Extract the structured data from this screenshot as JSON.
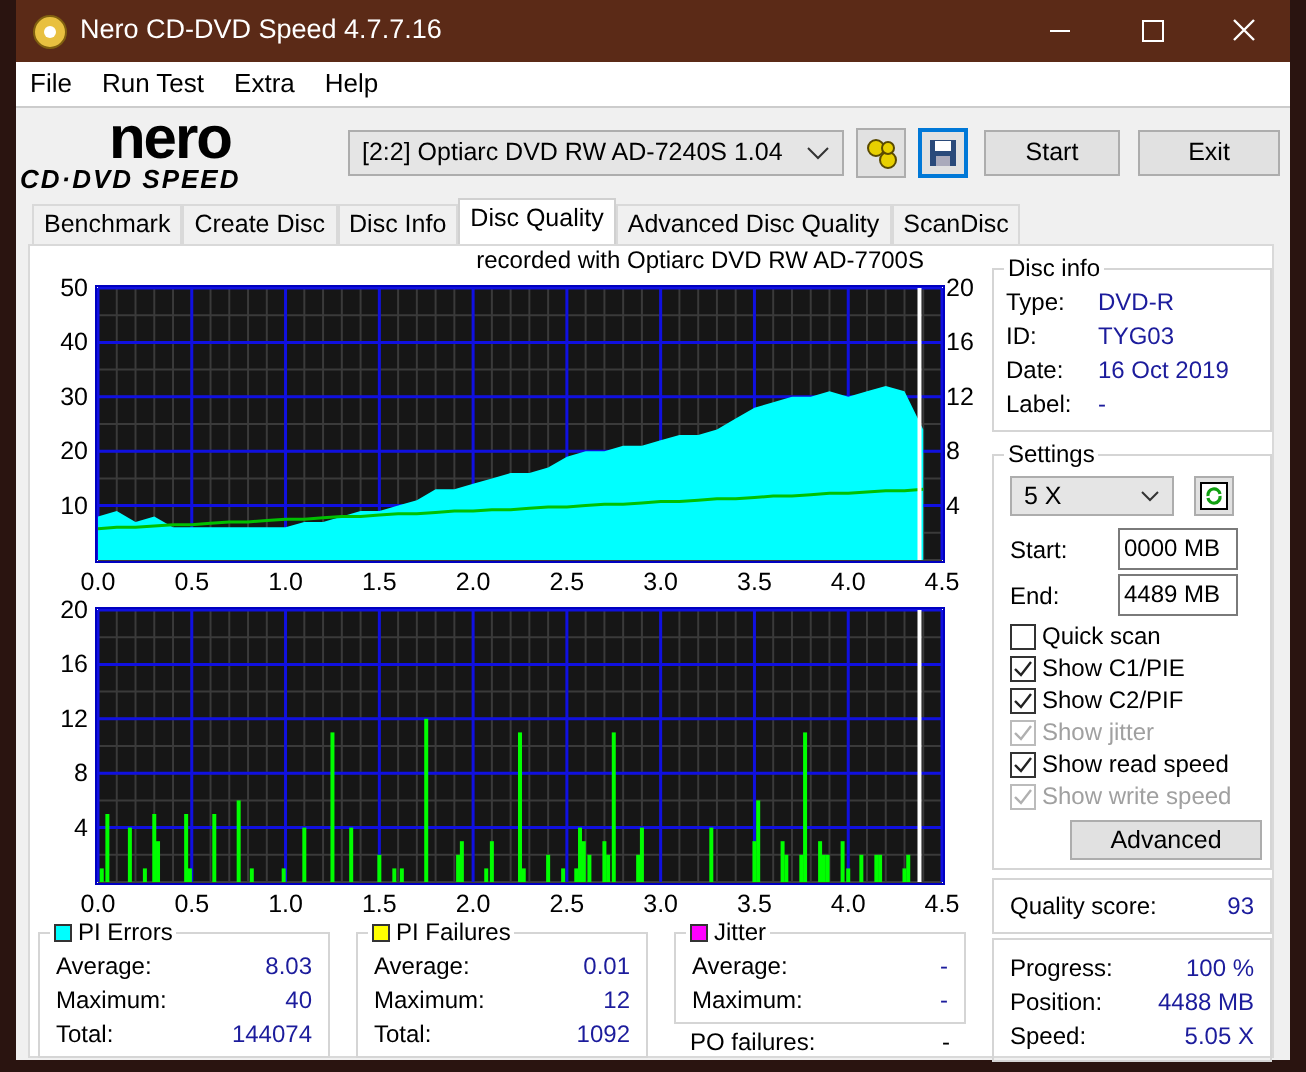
{
  "window": {
    "title": "Nero CD-DVD Speed 4.7.7.16"
  },
  "menu": [
    "File",
    "Run Test",
    "Extra",
    "Help"
  ],
  "logo": {
    "line1": "nero",
    "line2": "CD·DVD SPEED"
  },
  "toolbar": {
    "drive": "[2:2]   Optiarc DVD RW AD-7240S 1.04",
    "buttons": [
      "Start",
      "Exit"
    ]
  },
  "tabs": [
    {
      "label": "Benchmark",
      "selected": false
    },
    {
      "label": "Create Disc",
      "selected": false
    },
    {
      "label": "Disc Info",
      "selected": false
    },
    {
      "label": "Disc Quality",
      "selected": true
    },
    {
      "label": "Advanced Disc Quality",
      "selected": false
    },
    {
      "label": "ScanDisc",
      "selected": false
    }
  ],
  "chart_caption": "recorded with Optiarc  DVD RW AD-7700S",
  "pi_chart": {
    "chart_data": {
      "type": "area",
      "xlim": [
        0,
        4.5
      ],
      "ylim": [
        0,
        50
      ],
      "y2lim": [
        0,
        20
      ],
      "xticks": [
        {
          "value": 0,
          "label": "0.0"
        },
        {
          "value": 0.5,
          "label": "0.5"
        },
        {
          "value": 1,
          "label": "1.0"
        },
        {
          "value": 1.5,
          "label": "1.5"
        },
        {
          "value": 2,
          "label": "2.0"
        },
        {
          "value": 2.5,
          "label": "2.5"
        },
        {
          "value": 3,
          "label": "3.0"
        },
        {
          "value": 3.5,
          "label": "3.5"
        },
        {
          "value": 4,
          "label": "4.0"
        },
        {
          "value": 4.5,
          "label": "4.5"
        }
      ],
      "yticks": [
        10,
        20,
        30,
        40,
        50
      ],
      "y2ticks": [
        4,
        8,
        12,
        16,
        20
      ],
      "x": [
        0,
        0.1,
        0.2,
        0.3,
        0.4,
        0.5,
        0.6,
        0.7,
        0.8,
        0.9,
        1,
        1.1,
        1.2,
        1.3,
        1.4,
        1.5,
        1.6,
        1.7,
        1.8,
        1.9,
        2,
        2.1,
        2.2,
        2.3,
        2.4,
        2.5,
        2.6,
        2.7,
        2.8,
        2.9,
        3,
        3.1,
        3.2,
        3.3,
        3.4,
        3.5,
        3.6,
        3.7,
        3.8,
        3.9,
        4,
        4.1,
        4.2,
        4.3,
        4.4
      ],
      "series": [
        {
          "color": "#00ffff",
          "values": [
            8,
            9,
            7,
            8,
            6,
            6,
            6,
            6,
            6,
            6,
            6,
            7,
            7,
            8,
            9,
            9,
            10,
            11,
            13,
            13,
            14,
            15,
            16,
            16,
            17,
            19,
            20,
            20,
            21,
            21,
            22,
            23,
            23,
            24,
            26,
            28,
            29,
            30,
            30,
            31,
            30,
            31,
            32,
            31,
            24
          ]
        },
        {
          "type": "line",
          "color": "#00c000",
          "axis": "y2",
          "values": [
            2.3,
            2.4,
            2.4,
            2.5,
            2.6,
            2.6,
            2.7,
            2.8,
            2.8,
            2.9,
            3.0,
            3.0,
            3.1,
            3.2,
            3.2,
            3.3,
            3.4,
            3.4,
            3.5,
            3.6,
            3.6,
            3.7,
            3.7,
            3.8,
            3.9,
            3.9,
            4.0,
            4.1,
            4.1,
            4.2,
            4.3,
            4.3,
            4.4,
            4.5,
            4.5,
            4.6,
            4.7,
            4.7,
            4.8,
            4.9,
            4.9,
            5.0,
            5.1,
            5.1,
            5.2
          ]
        }
      ],
      "grid": true,
      "ref_lines": [
        {
          "axis": "x",
          "value": 4.38,
          "color": "#ffffff"
        }
      ]
    }
  },
  "pif_chart": {
    "chart_data": {
      "type": "bar",
      "xlim": [
        0,
        4.5
      ],
      "ylim": [
        0,
        20
      ],
      "xticks": [
        {
          "value": 0,
          "label": "0.0"
        },
        {
          "value": 0.5,
          "label": "0.5"
        },
        {
          "value": 1,
          "label": "1.0"
        },
        {
          "value": 1.5,
          "label": "1.5"
        },
        {
          "value": 2,
          "label": "2.0"
        },
        {
          "value": 2.5,
          "label": "2.5"
        },
        {
          "value": 3,
          "label": "3.0"
        },
        {
          "value": 3.5,
          "label": "3.5"
        },
        {
          "value": 4,
          "label": "4.0"
        },
        {
          "value": 4.5,
          "label": "4.5"
        }
      ],
      "yticks": [
        4,
        8,
        12,
        16,
        20
      ],
      "x": [
        0.02,
        0.05,
        0.17,
        0.25,
        0.3,
        0.32,
        0.47,
        0.49,
        0.62,
        0.75,
        0.82,
        0.99,
        1.1,
        1.25,
        1.35,
        1.5,
        1.58,
        1.62,
        1.75,
        1.92,
        1.94,
        2.07,
        2.1,
        2.25,
        2.27,
        2.4,
        2.48,
        2.55,
        2.57,
        2.59,
        2.62,
        2.7,
        2.72,
        2.75,
        2.88,
        2.9,
        3.27,
        3.5,
        3.52,
        3.65,
        3.67,
        3.75,
        3.77,
        3.85,
        3.87,
        3.89,
        3.97,
        4.0,
        4.07,
        4.15,
        4.17,
        4.3,
        4.32
      ],
      "series": [
        {
          "color": "#00ff00",
          "values": [
            1,
            5,
            4,
            1,
            5,
            3,
            5,
            1,
            5,
            6,
            1,
            1,
            4,
            11,
            4,
            2,
            1,
            1,
            12,
            2,
            3,
            1,
            3,
            11,
            1,
            2,
            1,
            1,
            4,
            3,
            2,
            3,
            2,
            11,
            2,
            4,
            4,
            3,
            6,
            3,
            2,
            2,
            11,
            3,
            2,
            2,
            3,
            1,
            2,
            2,
            2,
            1,
            2
          ]
        }
      ],
      "grid": true,
      "ref_lines": [
        {
          "axis": "x",
          "value": 4.38,
          "color": "#ffffff"
        }
      ]
    }
  },
  "stats": [
    {
      "title": "PI Errors",
      "color": "#00ffff",
      "rows": [
        {
          "label": "Average:",
          "value": "8.03"
        },
        {
          "label": "Maximum:",
          "value": "40"
        },
        {
          "label": "Total:",
          "value": "144074"
        }
      ]
    },
    {
      "title": "PI Failures",
      "color": "#ffff00",
      "rows": [
        {
          "label": "Average:",
          "value": "0.01"
        },
        {
          "label": "Maximum:",
          "value": "12"
        },
        {
          "label": "Total:",
          "value": "1092"
        }
      ]
    },
    {
      "title": "Jitter",
      "color": "#ff00ff",
      "rows": [
        {
          "label": "Average:",
          "value": "-"
        },
        {
          "label": "Maximum:",
          "value": "-"
        }
      ]
    }
  ],
  "po_failures": {
    "label": "PO failures:",
    "value": "-"
  },
  "disc_info": {
    "title": "Disc info",
    "rows": [
      {
        "label": "Type:",
        "value": "DVD-R"
      },
      {
        "label": "ID:",
        "value": "TYG03"
      },
      {
        "label": "Date:",
        "value": "16 Oct 2019"
      },
      {
        "label": "Label:",
        "value": "-"
      }
    ]
  },
  "settings": {
    "title": "Settings",
    "speed": "5 X",
    "start_label": "Start:",
    "start": "0000 MB",
    "end_label": "End:",
    "end": "4489 MB",
    "options": [
      {
        "label": "Quick scan",
        "checked": false,
        "disabled": false
      },
      {
        "label": "Show C1/PIE",
        "checked": true,
        "disabled": false
      },
      {
        "label": "Show C2/PIF",
        "checked": true,
        "disabled": false
      },
      {
        "label": "Show jitter",
        "checked": true,
        "disabled": true
      },
      {
        "label": "Show read speed",
        "checked": true,
        "disabled": false
      },
      {
        "label": "Show write speed",
        "checked": true,
        "disabled": true
      }
    ],
    "advanced": "Advanced"
  },
  "quality": {
    "label": "Quality score:",
    "value": "93"
  },
  "progress": [
    {
      "label": "Progress:",
      "value": "100 %"
    },
    {
      "label": "Position:",
      "value": "4488 MB"
    },
    {
      "label": "Speed:",
      "value": "5.05 X"
    }
  ]
}
